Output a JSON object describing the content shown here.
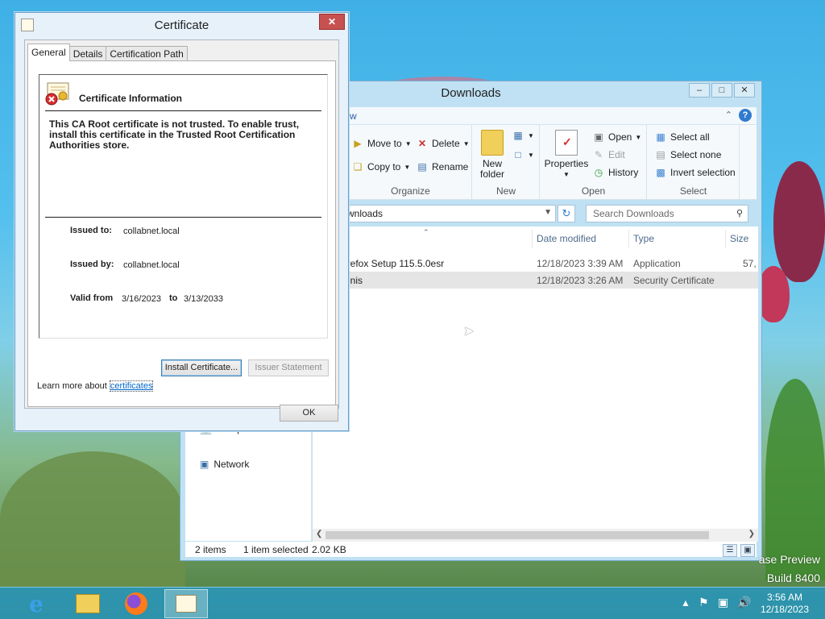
{
  "explorer": {
    "title": "Downloads",
    "ribbon_tab_fragment": "w",
    "organize": {
      "move_to": "Move to",
      "copy_to": "Copy to",
      "delete": "Delete",
      "rename": "Rename",
      "label": "Organize"
    },
    "new": {
      "new_folder": "New\nfolder",
      "label": "New"
    },
    "open": {
      "properties": "Properties",
      "open": "Open",
      "edit": "Edit",
      "history": "History",
      "label": "Open"
    },
    "select": {
      "select_all": "Select all",
      "select_none": "Select none",
      "invert_selection": "Invert selection",
      "label": "Select"
    },
    "address": "wnloads",
    "search_placeholder": "Search Downloads",
    "columns": {
      "name_fragment": "e",
      "date_modified": "Date modified",
      "type": "Type",
      "size": "Size"
    },
    "files": [
      {
        "name": "irefox Setup 115.5.0esr",
        "date": "12/18/2023 3:39 AM",
        "type": "Application",
        "size": "57,",
        "selected": false
      },
      {
        "name": "enis",
        "date": "12/18/2023 3:26 AM",
        "type": "Security Certificate",
        "size": "",
        "selected": true
      }
    ],
    "nav": {
      "computer": "Computer",
      "network": "Network"
    },
    "status": {
      "items": "2 items",
      "selected": "1 item selected",
      "size": "2.02 KB"
    }
  },
  "certificate": {
    "title": "Certificate",
    "tabs": [
      "General",
      "Details",
      "Certification Path"
    ],
    "heading": "Certificate Information",
    "warning": "This CA Root certificate is not trusted. To enable trust, install this certificate in the Trusted Root Certification Authorities store.",
    "issued_to_label": "Issued to:",
    "issued_to": "collabnet.local",
    "issued_by_label": "Issued by:",
    "issued_by": "collabnet.local",
    "valid_from_label": "Valid from",
    "valid_from": "3/16/2023",
    "to_label": "to",
    "valid_to": "3/13/2033",
    "install_button": "Install Certificate...",
    "issuer_statement_button": "Issuer Statement",
    "learn_more_text": "Learn more about ",
    "learn_more_link": "certificates",
    "ok_button": "OK"
  },
  "desktop": {
    "watermark_line1": "ase Preview",
    "watermark_line2": "Build 8400",
    "clock_time": "3:56 AM",
    "clock_date": "12/18/2023"
  },
  "colors": {
    "taskbar": "#2896be",
    "selection": "#e5e5e5",
    "link": "#0066cc",
    "close": "#c75050"
  }
}
